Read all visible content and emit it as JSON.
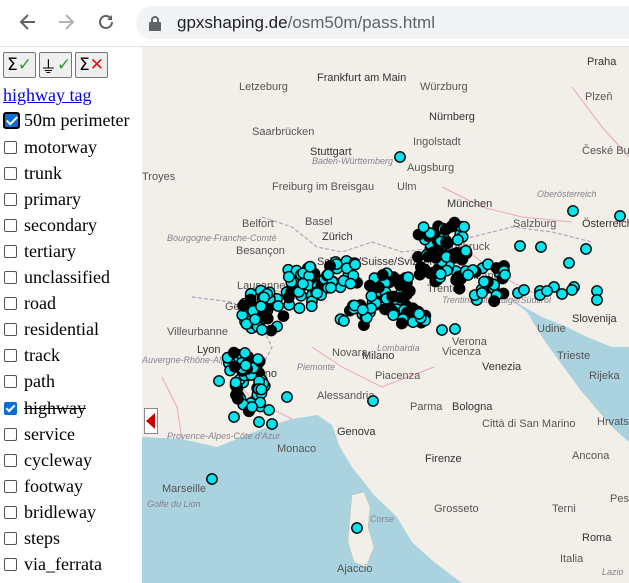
{
  "browser": {
    "url_domain": "gpxshaping.de",
    "url_path": "/osm50m/pass.html",
    "back_icon": "arrow-left-icon",
    "forward_icon": "arrow-right-icon",
    "reload_icon": "reload-icon",
    "lock_icon": "lock-icon"
  },
  "toolbar": {
    "select_all_label": "Σ✓",
    "select_sum_label": "⏚✓",
    "clear_all_label": "Σ✕"
  },
  "sidebar": {
    "highway_tag_link": "highway tag",
    "perimeter_label": "50m perimeter",
    "perimeter_checked": true,
    "filters": [
      {
        "label": "motorway",
        "checked": false
      },
      {
        "label": "trunk",
        "checked": false
      },
      {
        "label": "primary",
        "checked": false
      },
      {
        "label": "secondary",
        "checked": false
      },
      {
        "label": "tertiary",
        "checked": false
      },
      {
        "label": "unclassified",
        "checked": false
      },
      {
        "label": "road",
        "checked": false
      },
      {
        "label": "residential",
        "checked": false
      },
      {
        "label": "track",
        "checked": false
      },
      {
        "label": "path",
        "checked": false
      },
      {
        "label": "highway",
        "checked": true,
        "strikethrough": true
      },
      {
        "label": "service",
        "checked": false
      },
      {
        "label": "cycleway",
        "checked": false
      },
      {
        "label": "footway",
        "checked": false
      },
      {
        "label": "bridleway",
        "checked": false
      },
      {
        "label": "steps",
        "checked": false
      },
      {
        "label": "via_ferrata",
        "checked": false
      }
    ]
  },
  "map": {
    "labels": [
      "Praha",
      "Letzeburg",
      "Frankfurt am Main",
      "Würzburg",
      "Plzeň",
      "Saarbrücken",
      "Nürnberg",
      "Stuttgart",
      "Ingolstadt",
      "České Budějovice",
      "Baden-Württemberg",
      "Ulm",
      "Augsburg",
      "Troyes",
      "Freiburg im Breisgau",
      "München",
      "Oberösterreich",
      "Salzburg",
      "Belfort",
      "Basel",
      "Zürich",
      "Besançon",
      "Bourgogne-Franche-Comté",
      "Schweiz/Suisse/Svizzera",
      "Innsbruck",
      "Österreich",
      "Lausanne",
      "Genève",
      "Trento",
      "Trentino-Alto Adige/Südtirol",
      "Bolzano",
      "Udine",
      "Slovenija",
      "Villeurbanne",
      "Lyon",
      "Auvergne-Rhône-Alpes",
      "Milano",
      "Lombardia",
      "Verona",
      "Vicenza",
      "Venezia",
      "Trieste",
      "Rijeka",
      "Novara",
      "Torino",
      "Piemonte",
      "Piacenza",
      "Parma",
      "Bologna",
      "Alessandria",
      "Hrvatska",
      "Genova",
      "Città di San Marino",
      "Provence-Alpes-Côte d'Azur",
      "Monaco",
      "Firenze",
      "Ancona",
      "Marseille",
      "Italia",
      "Grosseto",
      "Golfe du Lion",
      "Corse",
      "Ajaccio",
      "Terni",
      "Roma",
      "Pescara",
      "Lazio"
    ],
    "toggle_icon": "triangle-left-icon",
    "colors": {
      "active_dot": "#00e5ee",
      "dot_stroke": "#000000",
      "selected_dot": "#000000",
      "toggle": "#cc0000"
    }
  }
}
